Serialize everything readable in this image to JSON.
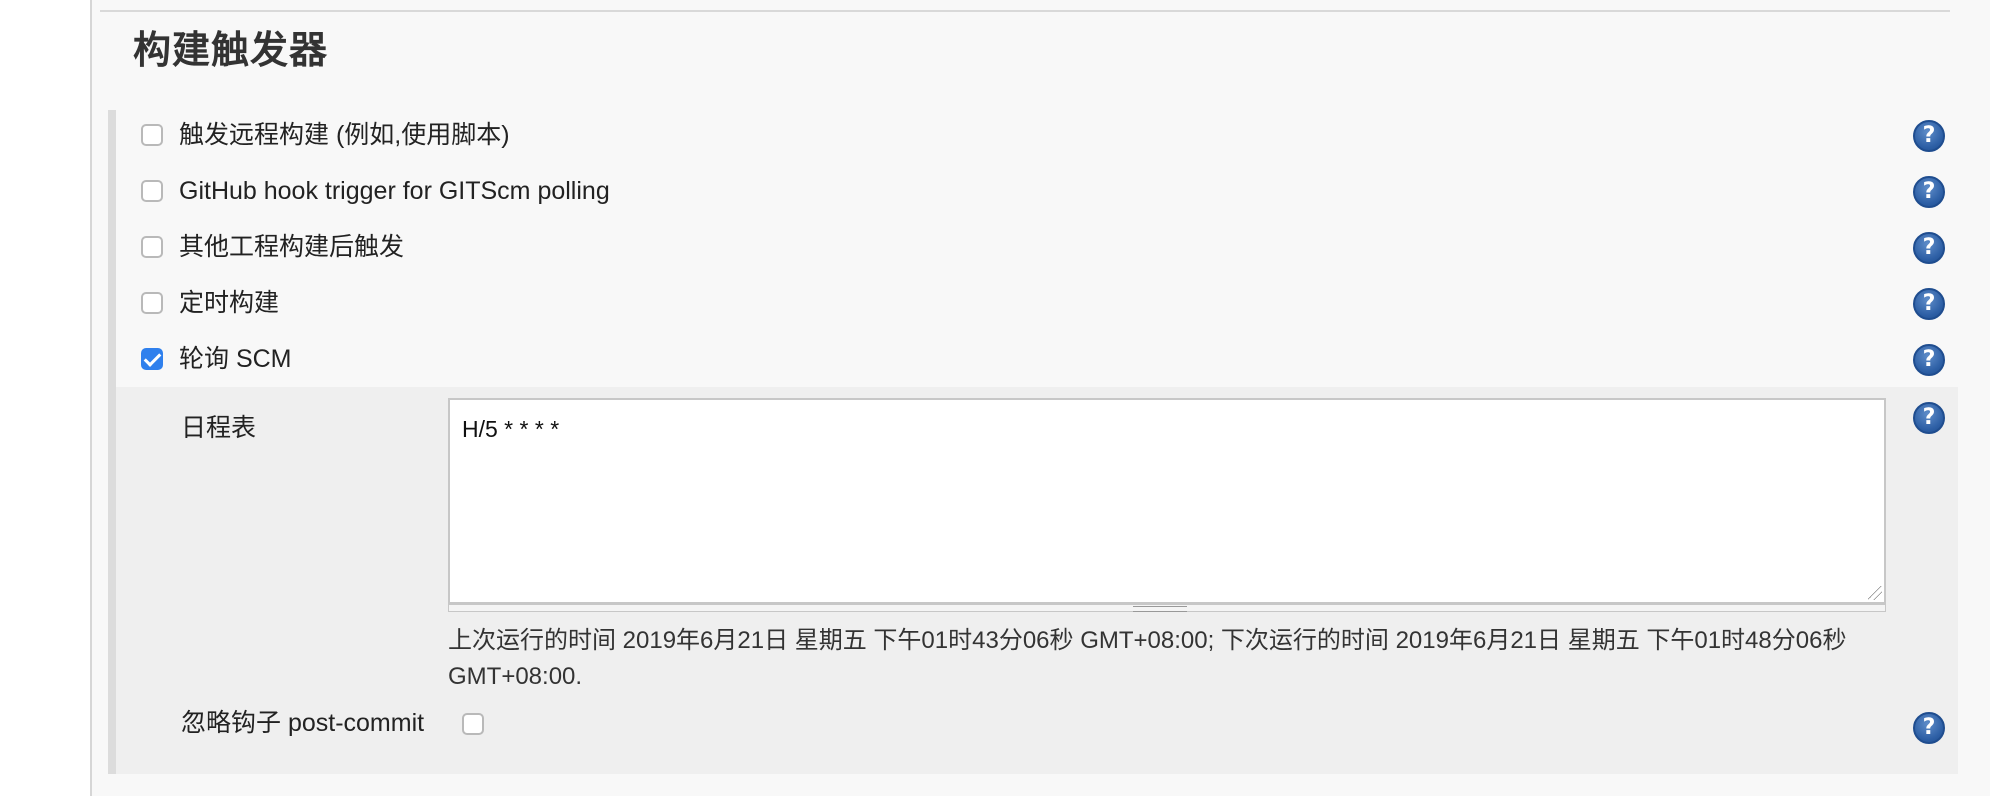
{
  "section": {
    "title": "构建触发器"
  },
  "triggers": [
    {
      "label": "触发远程构建 (例如,使用脚本)",
      "checked": false
    },
    {
      "label": "GitHub hook trigger for GITScm polling",
      "checked": false
    },
    {
      "label": "其他工程构建后触发",
      "checked": false
    },
    {
      "label": "定时构建",
      "checked": false
    },
    {
      "label": "轮询 SCM",
      "checked": true
    }
  ],
  "poll_scm": {
    "schedule_label": "日程表",
    "schedule_value": "H/5 * * * *",
    "run_info": "上次运行的时间 2019年6月21日 星期五 下午01时43分06秒 GMT+08:00; 下次运行的时间 2019年6月21日 星期五 下午01时48分06秒 GMT+08:00.",
    "ignore_post_commit_label": "忽略钩子 post-commit",
    "ignore_post_commit_checked": false
  },
  "help_icon_glyph": "?",
  "colors": {
    "accent": "#2f80ed",
    "help_icon": "#2d5fa5"
  }
}
